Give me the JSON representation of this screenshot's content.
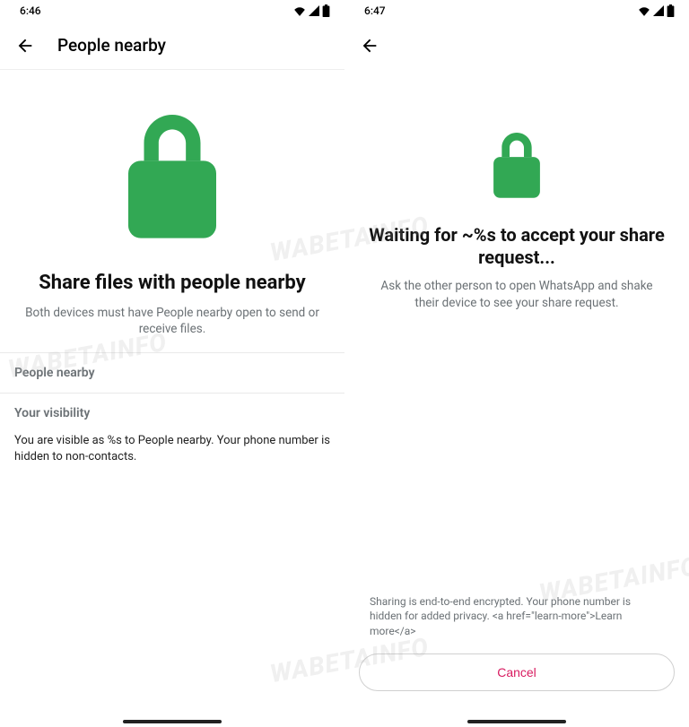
{
  "watermark": "WABETAINFO",
  "left": {
    "status_time": "6:46",
    "title": "People nearby",
    "hero_title": "Share files with people nearby",
    "hero_sub": "Both devices must have People nearby open to send or receive files.",
    "section1_header": "People nearby",
    "section2_header": "Your visibility",
    "section2_body": "You are visible as %s to People nearby. Your phone number is hidden to non-contacts."
  },
  "right": {
    "status_time": "6:47",
    "hero_title": "Waiting for ~%s to accept your share request...",
    "hero_sub": "Ask the other person to open WhatsApp and shake their device to see your share request.",
    "privacy": "Sharing is end-to-end encrypted. Your phone number is hidden for added privacy. <a href=\"learn-more\">Learn more</a>",
    "cancel_label": "Cancel"
  },
  "colors": {
    "accent_green": "#32a854",
    "link_pink": "#d81b60"
  }
}
